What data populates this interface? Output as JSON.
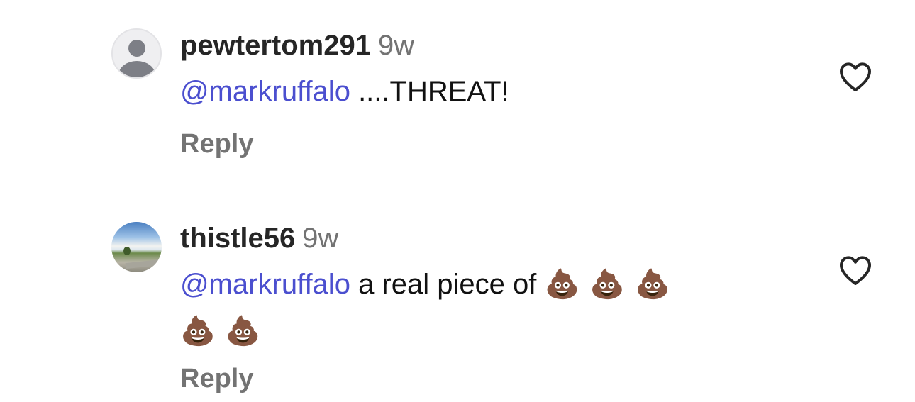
{
  "comments": [
    {
      "username": "pewtertom291",
      "time": "9w",
      "mention": "@markruffalo",
      "text": " ....THREAT!",
      "emojis_line1": "",
      "emojis_line2": "",
      "reply_label": "Reply",
      "avatar": "default-profile-avatar"
    },
    {
      "username": "thistle56",
      "time": "9w",
      "mention": "@markruffalo",
      "text": " a real piece of ",
      "emojis_line1": "💩💩💩",
      "emojis_line2": "💩💩",
      "reply_label": "Reply",
      "avatar": "landscape-photo-avatar"
    }
  ],
  "icons": {
    "like": "heart-outline-icon"
  },
  "colors": {
    "mention": "#4b4fcf",
    "secondary_text": "#737373",
    "icon": "#262626"
  }
}
